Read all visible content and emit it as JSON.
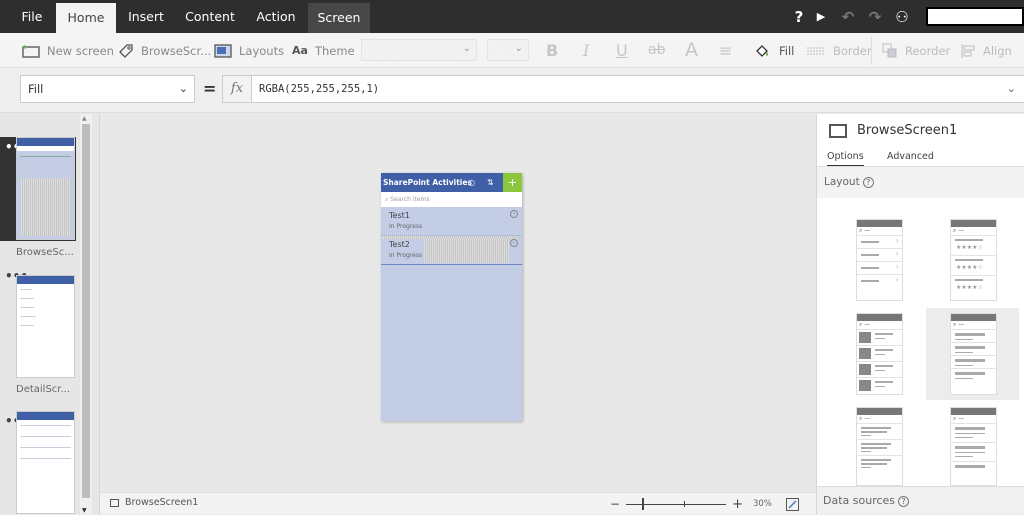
{
  "menu": {
    "tabs": [
      {
        "label": "File"
      },
      {
        "label": "Home"
      },
      {
        "label": "Insert"
      },
      {
        "label": "Content"
      },
      {
        "label": "Action"
      },
      {
        "label": "Screen"
      }
    ],
    "active_tab": "Home",
    "icons": [
      "help-icon",
      "play-icon",
      "undo-icon",
      "redo-icon",
      "add-user-icon"
    ],
    "help_glyph": "?",
    "play_glyph": "▶",
    "undo_glyph": "↶",
    "redo_glyph": "↷",
    "user_glyph": "⚇"
  },
  "ribbon": {
    "new_screen_label": "New screen",
    "browse_screen_label": "BrowseScr...",
    "layouts_label": "Layouts",
    "theme_label": "Theme",
    "bold_glyph": "B",
    "italic_glyph": "I",
    "underline_glyph": "U",
    "strike_glyph": "ab",
    "fontsize_glyph": "A",
    "align_glyph": "≡",
    "fill_label": "Fill",
    "border_label": "Border",
    "reorder_label": "Reorder",
    "align_label": "Align"
  },
  "formula_bar": {
    "property": "Fill",
    "equals": "=",
    "fx": "fx",
    "formula": "RGBA(255,255,255,1)"
  },
  "screens_panel": {
    "screens": [
      {
        "label": "BrowseSc...",
        "selected": true
      },
      {
        "label": "DetailScr...",
        "selected": false
      },
      {
        "label": "",
        "selected": false
      }
    ],
    "more_glyph": "•••"
  },
  "app_preview": {
    "title": "SharePoint Activities",
    "refresh_glyph": "○",
    "sort_glyph": "⇅",
    "add_glyph": "+",
    "search_placeholder": "Search items",
    "items": [
      {
        "title": "Test1",
        "status": "In Progress"
      },
      {
        "title": "Test2",
        "status": "In Progress"
      }
    ],
    "arrow_glyph": "›",
    "header_color": "#3f5fa6",
    "add_color": "#8cc63f",
    "fill_color": "#c3cde6"
  },
  "status_bar": {
    "screen_name": "BrowseScreen1",
    "zoom_minus": "−",
    "zoom_plus": "+",
    "zoom_level": "30%",
    "zoom_percent": 30
  },
  "properties_panel": {
    "screen_name": "BrowseScreen1",
    "tabs": [
      {
        "label": "Options"
      },
      {
        "label": "Advanced"
      }
    ],
    "active_tab": "Options",
    "layout_label": "Layout",
    "help_glyph": "?",
    "layouts": [
      {
        "name": "list-with-arrows"
      },
      {
        "name": "list-with-ratings"
      },
      {
        "name": "list-with-images"
      },
      {
        "name": "list-title-subtitle",
        "selected": true
      },
      {
        "name": "list-two-lines"
      },
      {
        "name": "list-title-body"
      }
    ],
    "data_sources_label": "Data sources"
  }
}
